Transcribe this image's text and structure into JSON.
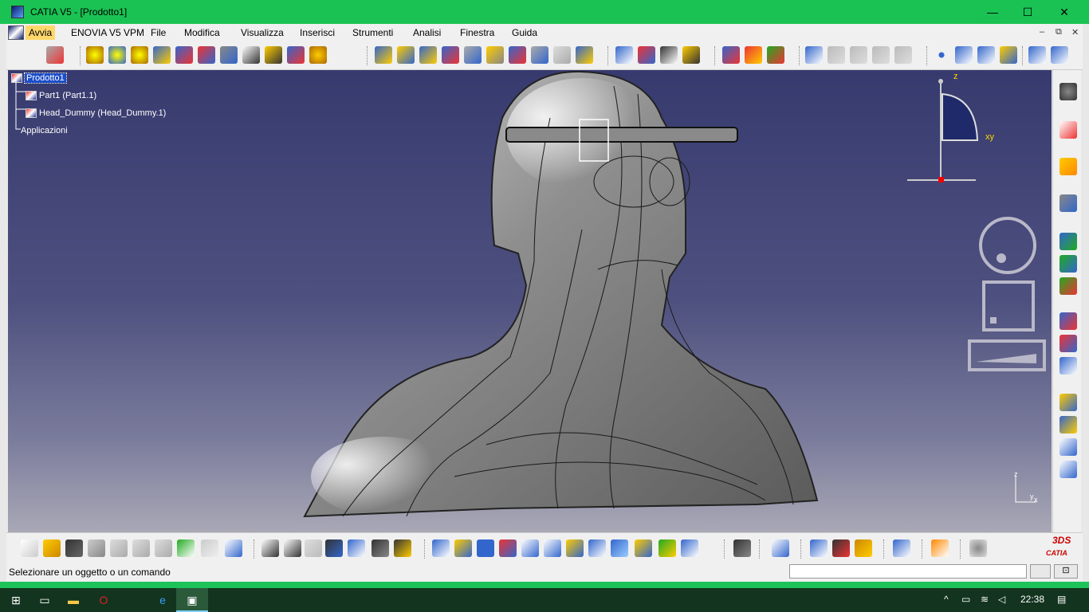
{
  "window": {
    "title": "CATIA V5 - [Prodotto1]",
    "minimize": "—",
    "maximize": "☐",
    "close": "✕"
  },
  "menu": {
    "items": [
      "Avvia",
      "ENOVIA V5 VPM",
      "File",
      "Modifica",
      "Visualizza",
      "Inserisci",
      "Strumenti",
      "Analisi",
      "Finestra",
      "Guida"
    ],
    "mdi_min": "–",
    "mdi_restore": "⧉",
    "mdi_close": "✕"
  },
  "tree": {
    "root": "Prodotto1",
    "children": [
      "Part1 (Part1.1)",
      "Head_Dummy (Head_Dummy.1)"
    ],
    "applications": "Applicazioni"
  },
  "compass": {
    "z_label": "z",
    "xy_label": "xy"
  },
  "mini_axis": {
    "z": "z",
    "y": "y",
    "x": "x"
  },
  "status": {
    "message": "Selezionare un oggetto o un comando",
    "command_value": ""
  },
  "logo": {
    "brand": "CATIA",
    "mark": "3DS"
  },
  "taskbar": {
    "clock": "22:38",
    "start_icon": "windows-start-icon",
    "apps": [
      "task-view-icon",
      "file-explorer-icon",
      "opera-icon",
      "edge-icon",
      "catia-icon"
    ]
  },
  "colors": {
    "titlebar": "#19c253",
    "viewport_top": "#373a6e",
    "viewport_bottom": "#a9a8b6",
    "selection": "#1d4ec9",
    "taskbar": "#13351f"
  }
}
